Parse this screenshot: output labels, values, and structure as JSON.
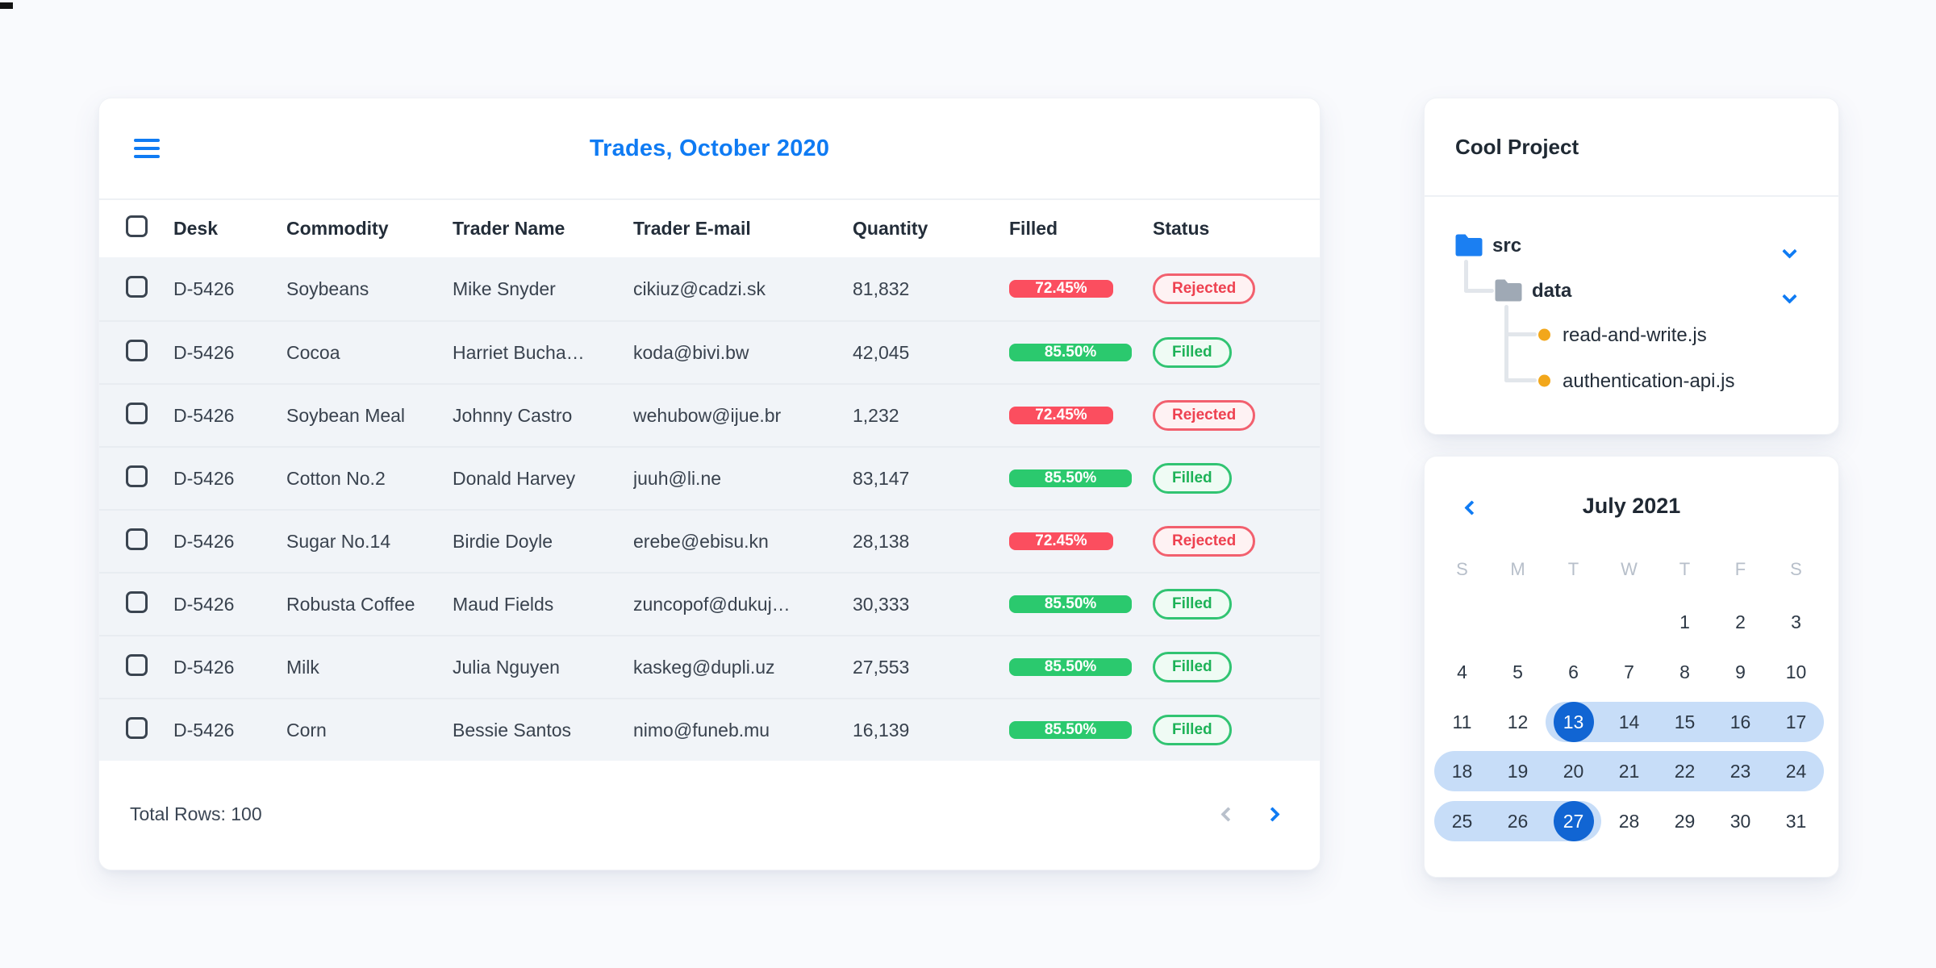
{
  "page": {
    "corner_mark": true
  },
  "colors": {
    "accent_blue": "#0f7bf3",
    "selected_blue": "#1165d3",
    "range_blue": "#c7ddf8",
    "badge_red": "#fb4e5f",
    "badge_green": "#2bc96e",
    "row_bg": "#f1f4f8"
  },
  "icons": {
    "menu": "hamburger-icon",
    "tree_expand": "chevron-down-icon",
    "calendar_prev": "chevron-left-icon",
    "pagination_prev": "chevron-left-icon",
    "pagination_next": "chevron-right-icon",
    "folder": "folder-icon",
    "file": "bullet-dot-icon"
  },
  "trades_card": {
    "title": "Trades, October 2020",
    "columns": [
      "Desk",
      "Commodity",
      "Trader Name",
      "Trader E-mail",
      "Quantity",
      "Filled",
      "Status"
    ],
    "rows": [
      {
        "desk": "D-5426",
        "commodity": "Soybeans",
        "trader": "Mike Snyder",
        "email": "cikiuz@cadzi.sk",
        "quantity": "81,832",
        "filled_pct": "72.45%",
        "filled_value": 72.45,
        "status": "Rejected"
      },
      {
        "desk": "D-5426",
        "commodity": "Cocoa",
        "trader": "Harriet Bucha…",
        "email": "koda@bivi.bw",
        "quantity": "42,045",
        "filled_pct": "85.50%",
        "filled_value": 85.5,
        "status": "Filled"
      },
      {
        "desk": "D-5426",
        "commodity": "Soybean Meal",
        "trader": "Johnny Castro",
        "email": "wehubow@ijue.br",
        "quantity": "1,232",
        "filled_pct": "72.45%",
        "filled_value": 72.45,
        "status": "Rejected"
      },
      {
        "desk": "D-5426",
        "commodity": "Cotton No.2",
        "trader": "Donald Harvey",
        "email": "juuh@li.ne",
        "quantity": "83,147",
        "filled_pct": "85.50%",
        "filled_value": 85.5,
        "status": "Filled"
      },
      {
        "desk": "D-5426",
        "commodity": "Sugar No.14",
        "trader": "Birdie Doyle",
        "email": "erebe@ebisu.kn",
        "quantity": "28,138",
        "filled_pct": "72.45%",
        "filled_value": 72.45,
        "status": "Rejected"
      },
      {
        "desk": "D-5426",
        "commodity": "Robusta Coffee",
        "trader": "Maud Fields",
        "email": "zuncopof@dukuj…",
        "quantity": "30,333",
        "filled_pct": "85.50%",
        "filled_value": 85.5,
        "status": "Filled"
      },
      {
        "desk": "D-5426",
        "commodity": "Milk",
        "trader": "Julia Nguyen",
        "email": "kaskeg@dupli.uz",
        "quantity": "27,553",
        "filled_pct": "85.50%",
        "filled_value": 85.5,
        "status": "Filled"
      },
      {
        "desk": "D-5426",
        "commodity": "Corn",
        "trader": "Bessie Santos",
        "email": "nimo@funeb.mu",
        "quantity": "16,139",
        "filled_pct": "85.50%",
        "filled_value": 85.5,
        "status": "Filled"
      }
    ],
    "footer": {
      "total_label": "Total Rows: 100"
    }
  },
  "project_card": {
    "title": "Cool Project",
    "tree": {
      "root": {
        "label": "src",
        "type": "folder",
        "expanded": true
      },
      "child": {
        "label": "data",
        "type": "folder",
        "expanded": true
      },
      "files": [
        {
          "label": "read-and-write.js"
        },
        {
          "label": "authentication-api.js"
        }
      ]
    }
  },
  "calendar_card": {
    "title": "July 2021",
    "weekdays": [
      "S",
      "M",
      "T",
      "W",
      "T",
      "F",
      "S"
    ],
    "weeks": [
      [
        {
          "d": ""
        },
        {
          "d": ""
        },
        {
          "d": ""
        },
        {
          "d": ""
        },
        {
          "d": "1"
        },
        {
          "d": "2"
        },
        {
          "d": "3"
        }
      ],
      [
        {
          "d": "4"
        },
        {
          "d": "5"
        },
        {
          "d": "6"
        },
        {
          "d": "7"
        },
        {
          "d": "8"
        },
        {
          "d": "9"
        },
        {
          "d": "10"
        }
      ],
      [
        {
          "d": "11"
        },
        {
          "d": "12"
        },
        {
          "d": "13",
          "sel": true
        },
        {
          "d": "14"
        },
        {
          "d": "15"
        },
        {
          "d": "16"
        },
        {
          "d": "17"
        }
      ],
      [
        {
          "d": "18"
        },
        {
          "d": "19"
        },
        {
          "d": "20"
        },
        {
          "d": "21"
        },
        {
          "d": "22"
        },
        {
          "d": "23"
        },
        {
          "d": "24"
        }
      ],
      [
        {
          "d": "25"
        },
        {
          "d": "26"
        },
        {
          "d": "27",
          "sel": true
        },
        {
          "d": "28"
        },
        {
          "d": "29"
        },
        {
          "d": "30"
        },
        {
          "d": "31"
        }
      ]
    ],
    "ranges": [
      {
        "week": 2,
        "from": 2,
        "to": 6
      },
      {
        "week": 3,
        "from": 0,
        "to": 6
      },
      {
        "week": 4,
        "from": 0,
        "to": 2
      }
    ],
    "selected_dates": [
      13,
      27
    ]
  }
}
